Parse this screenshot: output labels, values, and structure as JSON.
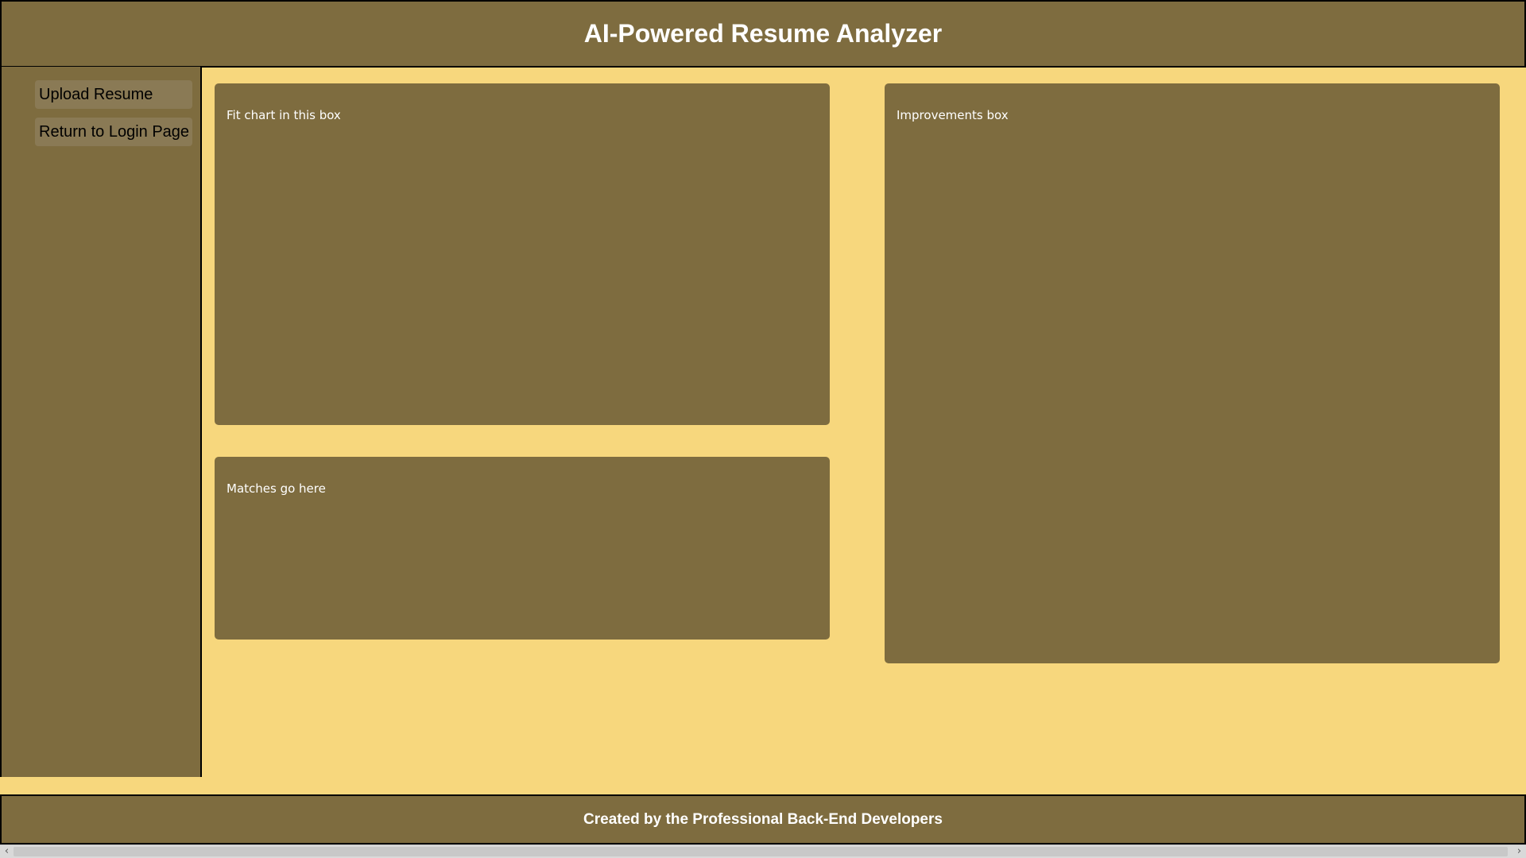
{
  "header": {
    "title": "AI-Powered Resume Analyzer"
  },
  "sidebar": {
    "items": [
      {
        "label": "Upload Resume"
      },
      {
        "label": "Return to Login Page"
      }
    ]
  },
  "main": {
    "fit_box": {
      "label": "Fit chart in this box"
    },
    "matches_box": {
      "label": "Matches go here"
    },
    "improvements_box": {
      "label": "Improvements box"
    }
  },
  "footer": {
    "text": "Created by the Professional Back-End Developers"
  },
  "scrollbar": {
    "left_icon": "chevron-left-icon",
    "right_icon": "chevron-right-icon"
  },
  "colors": {
    "background": "#f7d77d",
    "panel": "#7e6c3f",
    "button": "#8a7a55",
    "text_light": "#ffffff"
  }
}
